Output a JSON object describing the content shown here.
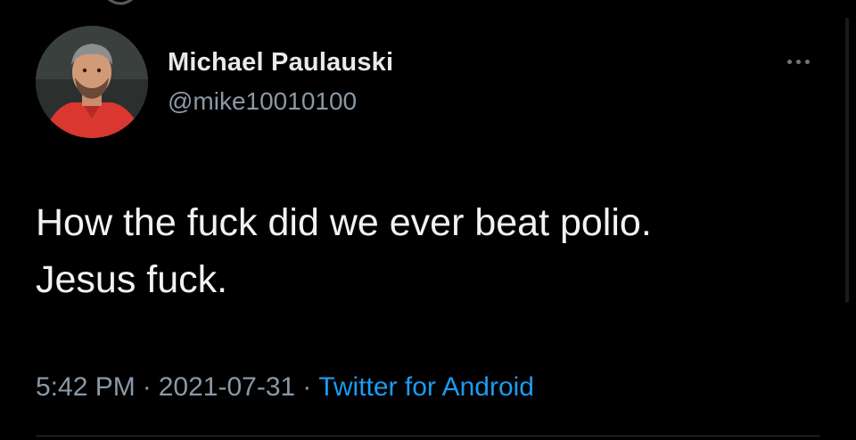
{
  "tweet": {
    "author": {
      "name": "Michael Paulauski",
      "handle": "@mike10010100"
    },
    "text": "How the fuck did we ever beat polio.\nJesus fuck.",
    "time": "5:42 PM",
    "date": "2021-07-31",
    "separator": "·",
    "source": "Twitter for Android"
  },
  "icons": {
    "more": "more-options-icon",
    "avatar": "user-avatar"
  },
  "colors": {
    "background": "#000000",
    "text": "#e7e9ea",
    "secondary": "#8b98a5",
    "link": "#1d9bf0"
  }
}
